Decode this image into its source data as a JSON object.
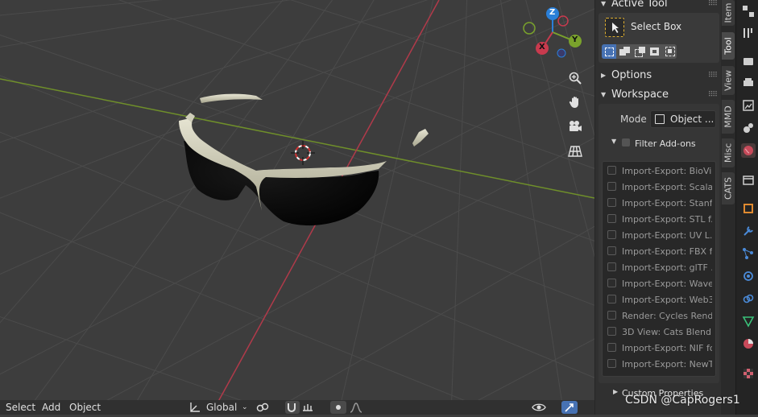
{
  "header_menu": {
    "select": "Select",
    "add": "Add",
    "object": "Object"
  },
  "transform": {
    "orientation": "Global"
  },
  "sidebar": {
    "active_tool_title": "Active Tool",
    "tool_name": "Select Box",
    "options_title": "Options",
    "workspace_title": "Workspace",
    "mode_label": "Mode",
    "mode_value": "Object ...",
    "filter_label": "Filter Add-ons",
    "addons": [
      "Import-Export: BioVi...",
      "Import-Export: Scala...",
      "Import-Export: Stanf...",
      "Import-Export: STL f...",
      "Import-Export: UV L...",
      "Import-Export: FBX f...",
      "Import-Export: glTF ...",
      "Import-Export: Wave...",
      "Import-Export: Web3...",
      "Render: Cycles Rend...",
      "3D View: Cats Blend...",
      "Import-Export: NIF fo...",
      "Import-Export: NewT..."
    ],
    "custom_properties": "Custom Properties"
  },
  "tabs": [
    "Item",
    "Tool",
    "View",
    "MMD",
    "Misc",
    "CATS"
  ],
  "gizmo": {
    "z": "Z",
    "y": "Y",
    "x": "X"
  },
  "watermark": "CSDN @CapRogers1",
  "colors": {
    "x_axis": "#c83a4e",
    "y_axis": "#7aa22c",
    "z_axis": "#2a7fd8",
    "background": "#3d3d3d",
    "panel": "#303030"
  }
}
